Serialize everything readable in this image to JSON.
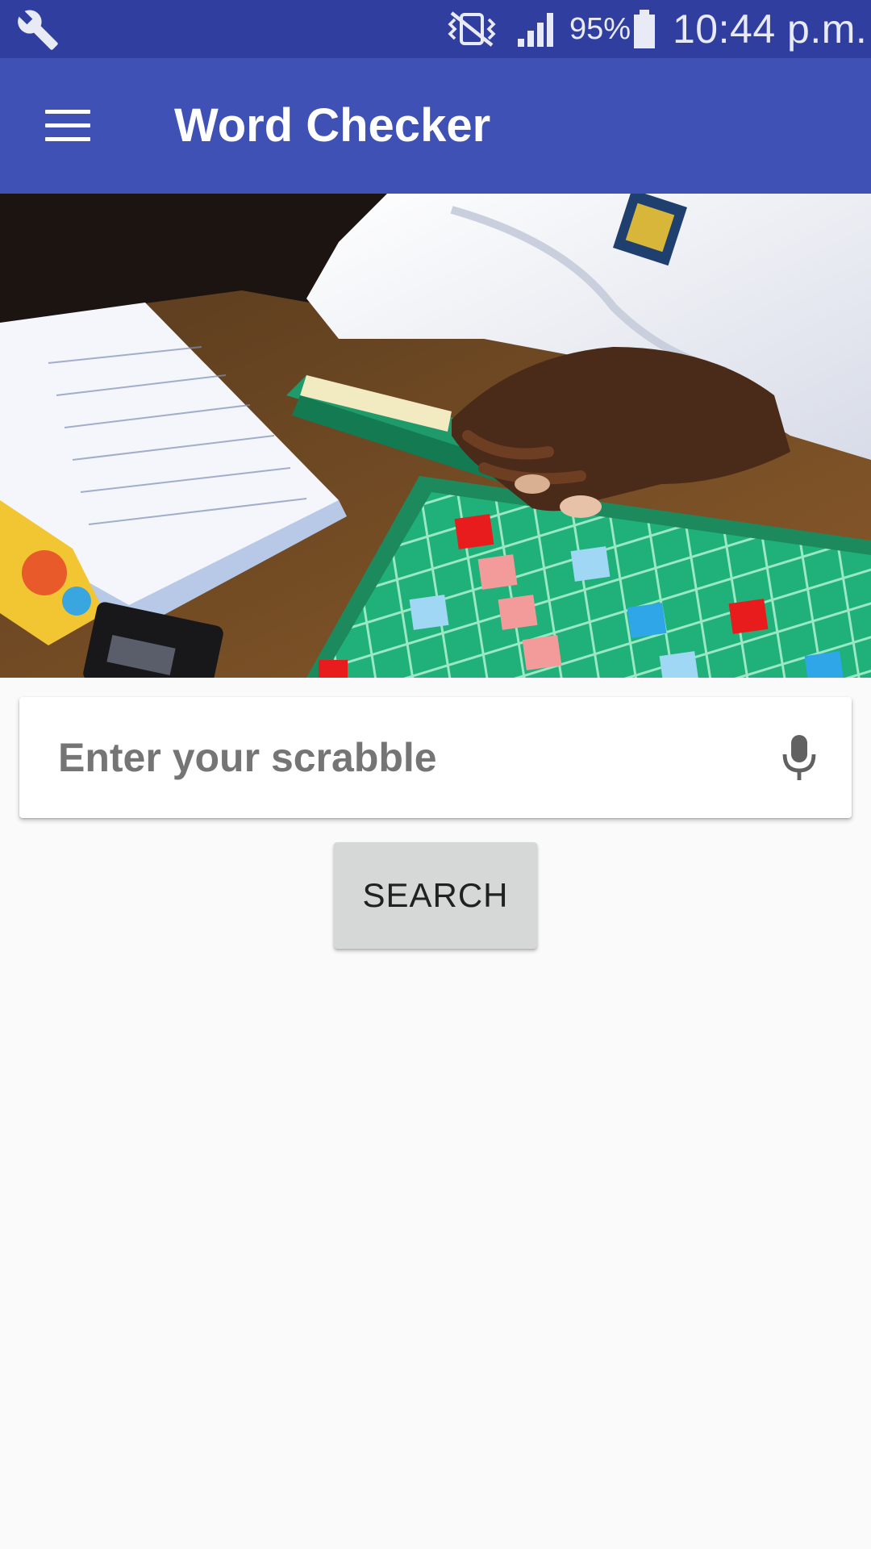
{
  "status_bar": {
    "battery_percent": "95%",
    "time": "10:44 p.m.",
    "icons": [
      "wrench-icon",
      "vibrate-icon",
      "signal-icon",
      "battery-icon"
    ]
  },
  "app_bar": {
    "title": "Word Checker",
    "menu_icon": "hamburger-menu-icon"
  },
  "hero": {
    "description_icon": "scrabble-board-photo"
  },
  "search": {
    "placeholder": "Enter your scrabble",
    "value": "",
    "mic_icon": "microphone-icon"
  },
  "search_button": {
    "label": "SEARCH"
  },
  "colors": {
    "status_bar": "#303f9f",
    "app_bar": "#3f51b5",
    "background": "#fafafa",
    "button": "#d6d7d7"
  }
}
